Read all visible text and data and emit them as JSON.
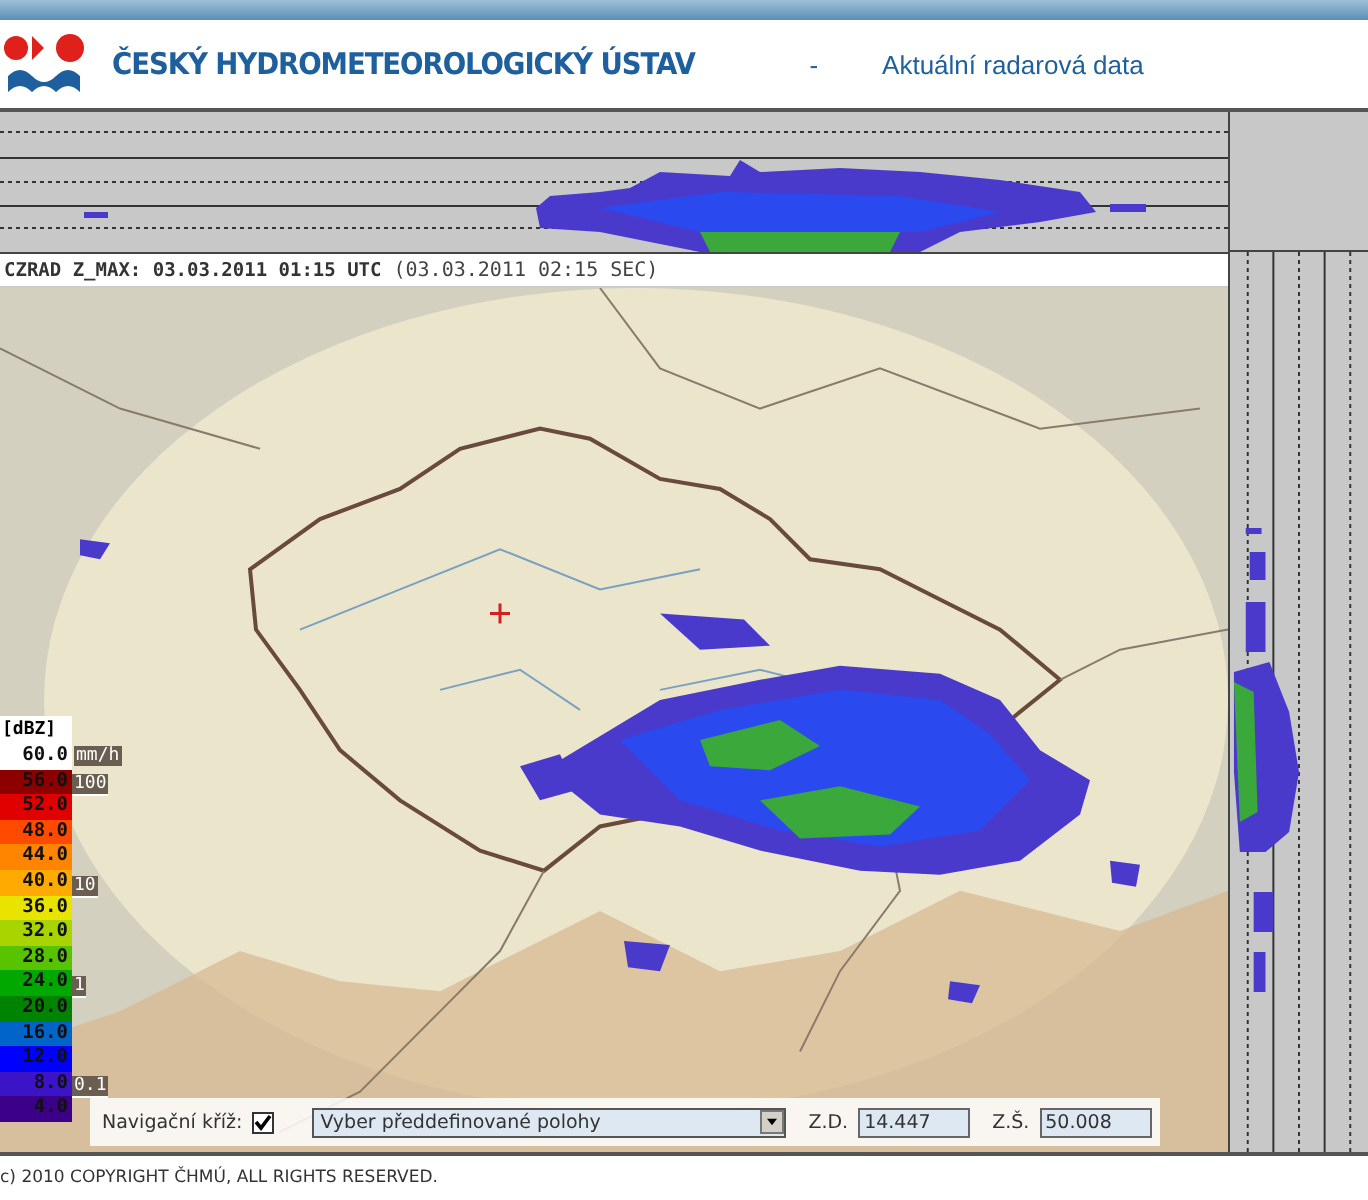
{
  "header": {
    "title": "ČESKÝ HYDROMETEOROLOGICKÝ ÚSTAV",
    "separator": "-",
    "subtitle": "Aktuální radarová data"
  },
  "radar": {
    "caption": "CZRAD Z_MAX: 03.03.2011 01:15 UTC",
    "caption_local": "(03.03.2011 02:15 SEC)"
  },
  "legend": {
    "unit": "[dBZ]",
    "rain_unit": "mm/h",
    "levels": [
      {
        "label": "60.0",
        "color": "#ffffff"
      },
      {
        "label": "56.0",
        "color": "#8c0000"
      },
      {
        "label": "52.0",
        "color": "#e00000"
      },
      {
        "label": "48.0",
        "color": "#ff4a00"
      },
      {
        "label": "44.0",
        "color": "#ff8400"
      },
      {
        "label": "40.0",
        "color": "#ffaa00"
      },
      {
        "label": "36.0",
        "color": "#e8e400"
      },
      {
        "label": "32.0",
        "color": "#a8d400"
      },
      {
        "label": "28.0",
        "color": "#58c400"
      },
      {
        "label": "24.0",
        "color": "#00a800"
      },
      {
        "label": "20.0",
        "color": "#008400"
      },
      {
        "label": "16.0",
        "color": "#0064c8"
      },
      {
        "label": "12.0",
        "color": "#0000ff"
      },
      {
        "label": "8.0",
        "color": "#3c14c8"
      },
      {
        "label": "4.0",
        "color": "#3c0088"
      }
    ],
    "rain_marks": [
      "100",
      "10",
      "1",
      "0.1"
    ]
  },
  "controls": {
    "cross_label": "Navigační kříž:",
    "cross_checked": true,
    "location_select": "Vyber předdefinované polohy",
    "lon_label": "Z.D.",
    "lon_value": "14.447",
    "lat_label": "Z.Š.",
    "lat_value": "50.008"
  },
  "footer": "c) 2010 COPYRIGHT ČHMÚ, ALL RIGHTS RESERVED."
}
